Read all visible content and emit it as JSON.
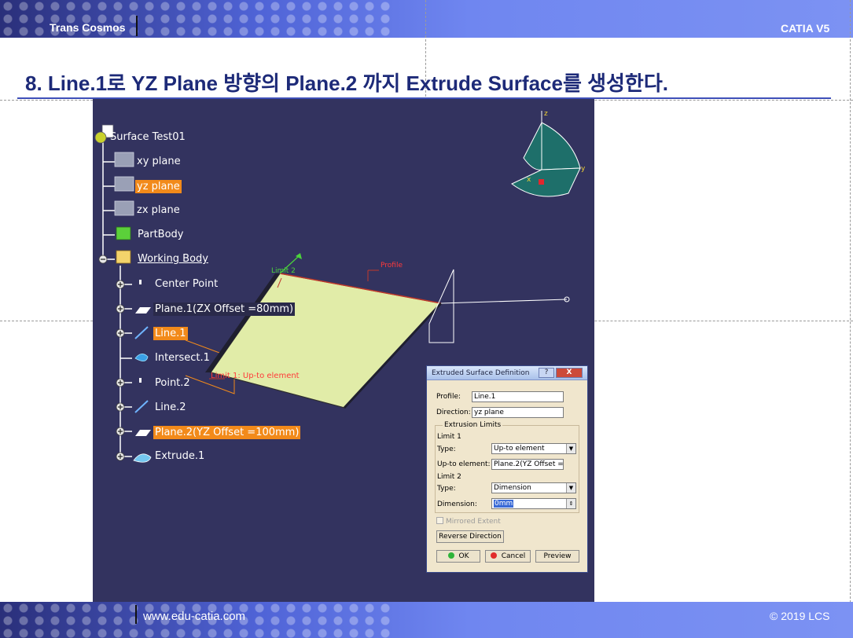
{
  "header": {
    "left_text": "Trans Cosmos",
    "right_text": "CATIA V5"
  },
  "footer": {
    "url": "www.edu-catia.com",
    "copyright": "© 2019 LCS"
  },
  "title": "8. Line.1로 YZ Plane 방향의 Plane.2 까지 Extrude Surface를 생성한다.",
  "tree": {
    "root": "Surface Test01",
    "xy_plane": "xy plane",
    "yz_plane": "yz plane",
    "zx_plane": "zx plane",
    "partbody": "PartBody",
    "working_body": "Working Body",
    "center_point": "Center Point",
    "plane1": "Plane.1(ZX Offset =80mm)",
    "line1": "Line.1",
    "intersect1": "Intersect.1",
    "point2": "Point.2",
    "line2": "Line.2",
    "plane2": "Plane.2(YZ Offset =100mm)",
    "extrude1": "Extrude.1"
  },
  "viewport": {
    "label_limit2": "Limit 2",
    "label_profile": "Profile",
    "label_limit1": "Limit 1: Up-to element",
    "compass_z": "z",
    "compass_x": "x",
    "compass_y": "y",
    "colors": {
      "background": "#33335f",
      "surface": "#e1eca8",
      "highlight": "#f28a1a"
    }
  },
  "dialog": {
    "title": "Extruded Surface Definition",
    "help_btn": "?",
    "close_btn": "X",
    "profile_label": "Profile:",
    "profile_value": "Line.1",
    "direction_label": "Direction:",
    "direction_value": "yz plane",
    "extrusion_limits_label": "Extrusion Limits",
    "limit1_label": "Limit 1",
    "limit1_type_label": "Type:",
    "limit1_type_value": "Up-to element",
    "upto_label": "Up-to element:",
    "upto_value": "Plane.2(YZ Offset =1",
    "limit2_label": "Limit 2",
    "limit2_type_label": "Type:",
    "limit2_type_value": "Dimension",
    "dimension_label": "Dimension:",
    "dimension_value": "0mm",
    "mirrored_label": "Mirrored Extent",
    "reverse_btn": "Reverse Direction",
    "ok_btn": "OK",
    "cancel_btn": "Cancel",
    "preview_btn": "Preview"
  }
}
